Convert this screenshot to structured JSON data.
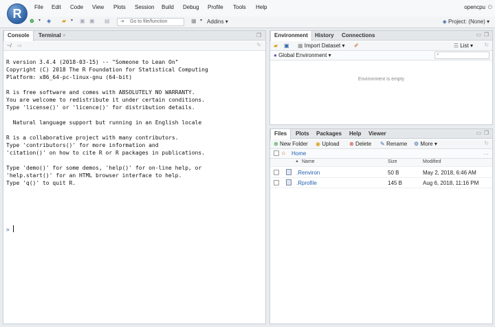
{
  "menu": [
    "File",
    "Edit",
    "Code",
    "View",
    "Plots",
    "Session",
    "Build",
    "Debug",
    "Profile",
    "Tools",
    "Help"
  ],
  "user": "opencpu",
  "toolbar": {
    "goto_placeholder": "Go to file/function",
    "addins_label": "Addins",
    "project_label": "Project: (None)"
  },
  "console": {
    "tabs": [
      "Console",
      "Terminal"
    ],
    "path": "~/",
    "lines": "R version 3.4.4 (2018-03-15) -- \"Someone to Lean On\"\nCopyright (C) 2018 The R Foundation for Statistical Computing\nPlatform: x86_64-pc-linux-gnu (64-bit)\n\nR is free software and comes with ABSOLUTELY NO WARRANTY.\nYou are welcome to redistribute it under certain conditions.\nType 'license()' or 'licence()' for distribution details.\n\n  Natural language support but running in an English locale\n\nR is a collaborative project with many contributors.\nType 'contributors()' for more information and\n'citation()' on how to cite R or R packages in publications.\n\nType 'demo()' for some demos, 'help()' for on-line help, or\n'help.start()' for an HTML browser interface to help.\nType 'q()' to quit R.",
    "prompt": ">"
  },
  "env": {
    "tabs": [
      "Environment",
      "History",
      "Connections"
    ],
    "import_label": "Import Dataset",
    "list_label": "List",
    "scope_label": "Global Environment",
    "empty_text": "Environment is empty"
  },
  "files": {
    "tabs": [
      "Files",
      "Plots",
      "Packages",
      "Help",
      "Viewer"
    ],
    "actions": {
      "new_folder": "New Folder",
      "upload": "Upload",
      "delete": "Delete",
      "rename": "Rename",
      "more": "More"
    },
    "breadcrumb": "Home",
    "columns": {
      "name": "Name",
      "size": "Size",
      "modified": "Modified"
    },
    "rows": [
      {
        "name": ".Renviron",
        "size": "50 B",
        "modified": "May 2, 2018, 6:46 AM"
      },
      {
        "name": ".Rprofile",
        "size": "145 B",
        "modified": "Aug 6, 2018, 11:16 PM"
      }
    ]
  },
  "colors": {
    "accent": "#2f62a4",
    "link": "#1f5fb0",
    "pane_bg": "#ffffff"
  }
}
